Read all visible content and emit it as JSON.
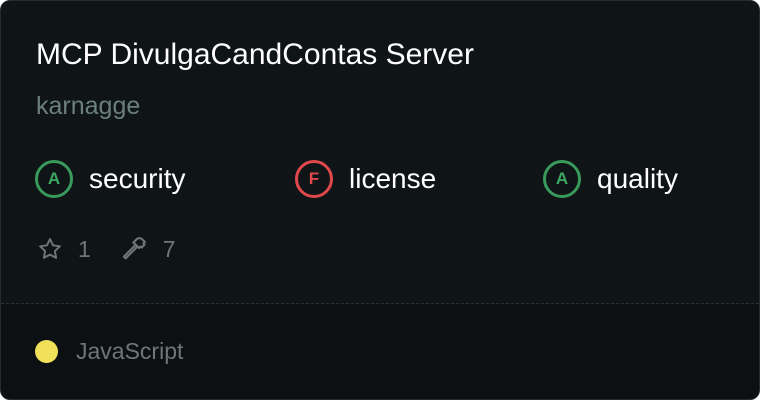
{
  "server": {
    "title": "MCP DivulgaCandContas Server",
    "author": "karnagge"
  },
  "grades": [
    {
      "letter": "A",
      "label": "security",
      "status": "good",
      "color": "#3ba863"
    },
    {
      "letter": "F",
      "label": "license",
      "status": "bad",
      "color": "#e0494c"
    },
    {
      "letter": "A",
      "label": "quality",
      "status": "good",
      "color": "#3ba863"
    }
  ],
  "stats": {
    "stars": "1",
    "stars_icon": "star-icon",
    "tools": "7",
    "tools_icon": "hammer-icon"
  },
  "language": {
    "name": "JavaScript",
    "color": "#f1e05a"
  }
}
